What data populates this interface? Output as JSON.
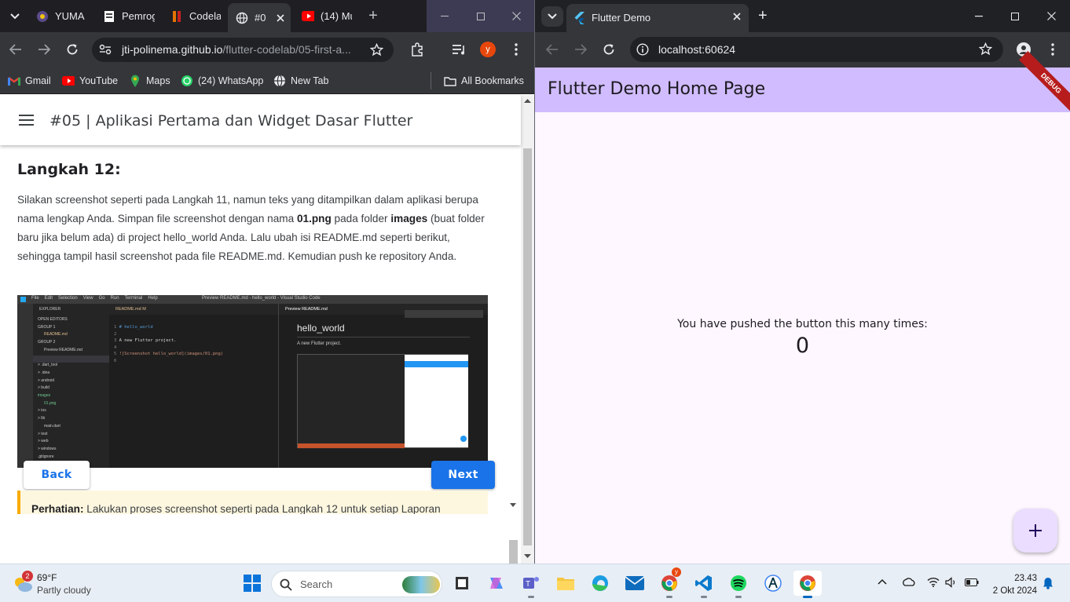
{
  "left_browser": {
    "tabs": [
      {
        "title": "YUMA",
        "icon": "profile-icon"
      },
      {
        "title": "Pemrog",
        "icon": "doc-icon"
      },
      {
        "title": "Codela",
        "icon": "codelab-icon"
      },
      {
        "title": "#0",
        "icon": "globe-icon",
        "active": true
      },
      {
        "title": "(14) Mu",
        "icon": "youtube-icon"
      }
    ],
    "new_tab_symbol": "+",
    "url_host": "jti-polinema.github.io",
    "url_path": "/flutter-codelab/05-first-a...",
    "profile_initial": "y",
    "bookmarks": [
      {
        "label": "Gmail",
        "icon": "gmail-icon"
      },
      {
        "label": "YouTube",
        "icon": "youtube-icon"
      },
      {
        "label": "Maps",
        "icon": "maps-icon"
      },
      {
        "label": "(24) WhatsApp",
        "icon": "whatsapp-icon"
      },
      {
        "label": "New Tab",
        "icon": "globe-icon"
      }
    ],
    "all_bookmarks": "All Bookmarks"
  },
  "codelab": {
    "page_title": "#05 | Aplikasi Pertama dan Widget Dasar Flutter",
    "step_title": "Langkah 12:",
    "body_parts": [
      "Silakan screenshot seperti pada Langkah 11, namun teks yang ditampilkan dalam aplikasi berupa nama lengkap Anda. Simpan file screenshot dengan nama ",
      "01.png",
      " pada folder ",
      "images",
      " (buat folder baru jika belum ada) di project hello_world Anda. Lalu ubah isi README.md seperti berikut, sehingga tampil hasil screenshot pada file README.md. Kemudian push ke repository Anda."
    ],
    "screenshot": {
      "window_title": "Preview README.md - hello_world - Visual Studio Code",
      "menu": [
        "File",
        "Edit",
        "Selection",
        "View",
        "Go",
        "Run",
        "Terminal",
        "Help"
      ],
      "explorer_label": "EXPLORER",
      "explorer_items": [
        "OPEN EDITORS",
        "GROUP 1",
        "README.md",
        "GROUP 2",
        "Preview README.md",
        "HELLO_WORLD",
        "> .dart_tool",
        "> .idea",
        "> android",
        "> build",
        "images",
        "01.png",
        "> ios",
        "> lib",
        "main.dart",
        "> test",
        "> web",
        "> windows",
        ".gitignore"
      ],
      "editor_tab": "README.md M",
      "preview_tab": "Preview README.md",
      "code_lines": [
        "# hello_world",
        "",
        "A new Flutter project.",
        "",
        "![Screenshot hello_world](images/01.png)",
        ""
      ],
      "preview_heading": "hello_world",
      "preview_text": "A new Flutter project."
    },
    "back_label": "Back",
    "next_label": "Next",
    "notice_bold": "Perhatian:",
    "notice_text": " Lakukan proses screenshot seperti pada Langkah 12 untuk setiap Laporan"
  },
  "right_browser": {
    "tab_title": "Flutter Demo",
    "url": "localhost:60624"
  },
  "flutter_app": {
    "title": "Flutter Demo Home Page",
    "debug_banner": "DEBUG",
    "counter_label": "You have pushed the button this many times:",
    "counter_value": "0",
    "fab_symbol": "+"
  },
  "taskbar": {
    "weather_temp": "69°F",
    "weather_desc": "Partly cloudy",
    "weather_badge": "2",
    "search_placeholder": "Search",
    "apps": [
      "start-icon",
      "search",
      "widgets-icon",
      "file-explorer-icon",
      "copilot-icon",
      "teams-icon",
      "folder-icon",
      "edge-icon",
      "mail-icon",
      "chrome-profile-icon",
      "vscode-icon",
      "spotify-icon",
      "android-studio-icon",
      "chrome-icon"
    ],
    "time": "23.43",
    "date": "2 Okt 2024"
  }
}
